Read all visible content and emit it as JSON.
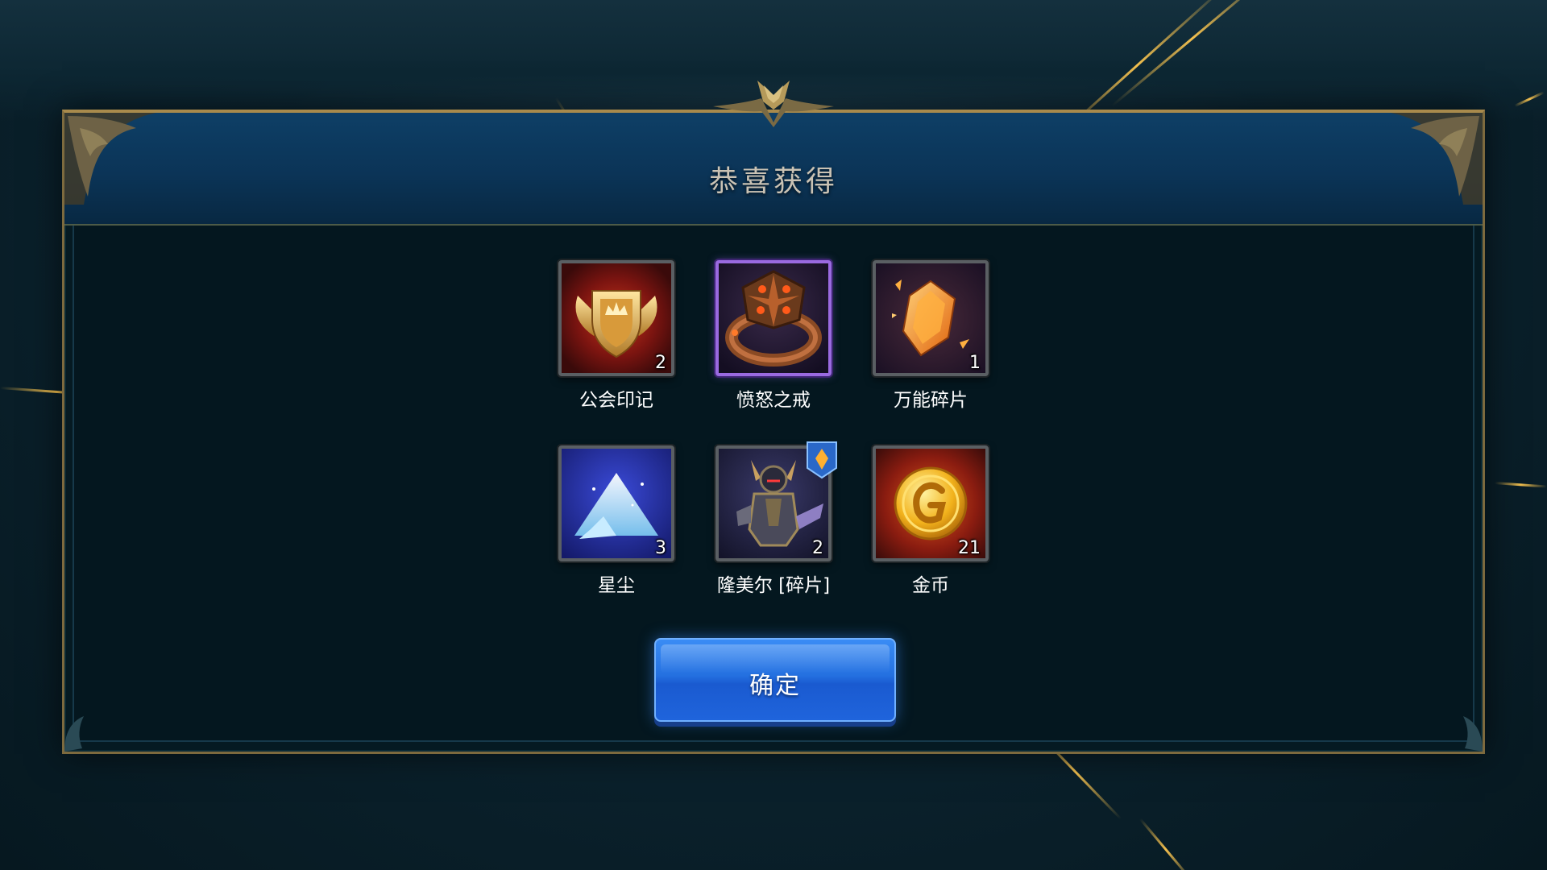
{
  "dialog": {
    "title": "恭喜获得",
    "confirm_label": "确定"
  },
  "rewards": [
    {
      "name": "公会印记",
      "count": "2",
      "icon": "guild-emblem-icon"
    },
    {
      "name": "愤怒之戒",
      "count": "",
      "icon": "ring-of-wrath-icon"
    },
    {
      "name": "万能碎片",
      "count": "1",
      "icon": "universal-shard-icon"
    },
    {
      "name": "星尘",
      "count": "3",
      "icon": "stardust-icon"
    },
    {
      "name": "隆美尔 [碎片]",
      "count": "2",
      "icon": "hero-fragment-icon"
    },
    {
      "name": "金币",
      "count": "21",
      "icon": "gold-coin-icon"
    }
  ],
  "colors": {
    "header": "#0e3f66",
    "frame_gold": "#a88a4c",
    "button": "#2470e0"
  }
}
